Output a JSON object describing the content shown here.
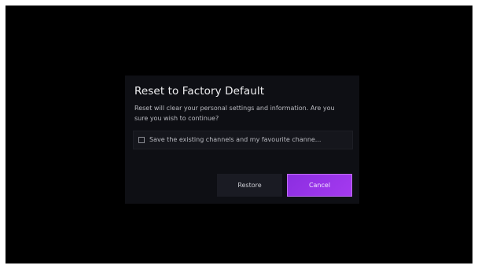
{
  "dialog": {
    "title": "Reset to Factory Default",
    "message": "Reset will clear your personal settings and information. Are you sure you wish to continue?",
    "checkbox": {
      "label": "Save the existing channels and my favourite channe...",
      "checked": false
    },
    "buttons": {
      "restore_label": "Restore",
      "cancel_label": "Cancel",
      "focused": "cancel"
    }
  },
  "colors": {
    "background": "#000000",
    "dialog": "#0e0f14",
    "accent": "#9b35ea"
  }
}
